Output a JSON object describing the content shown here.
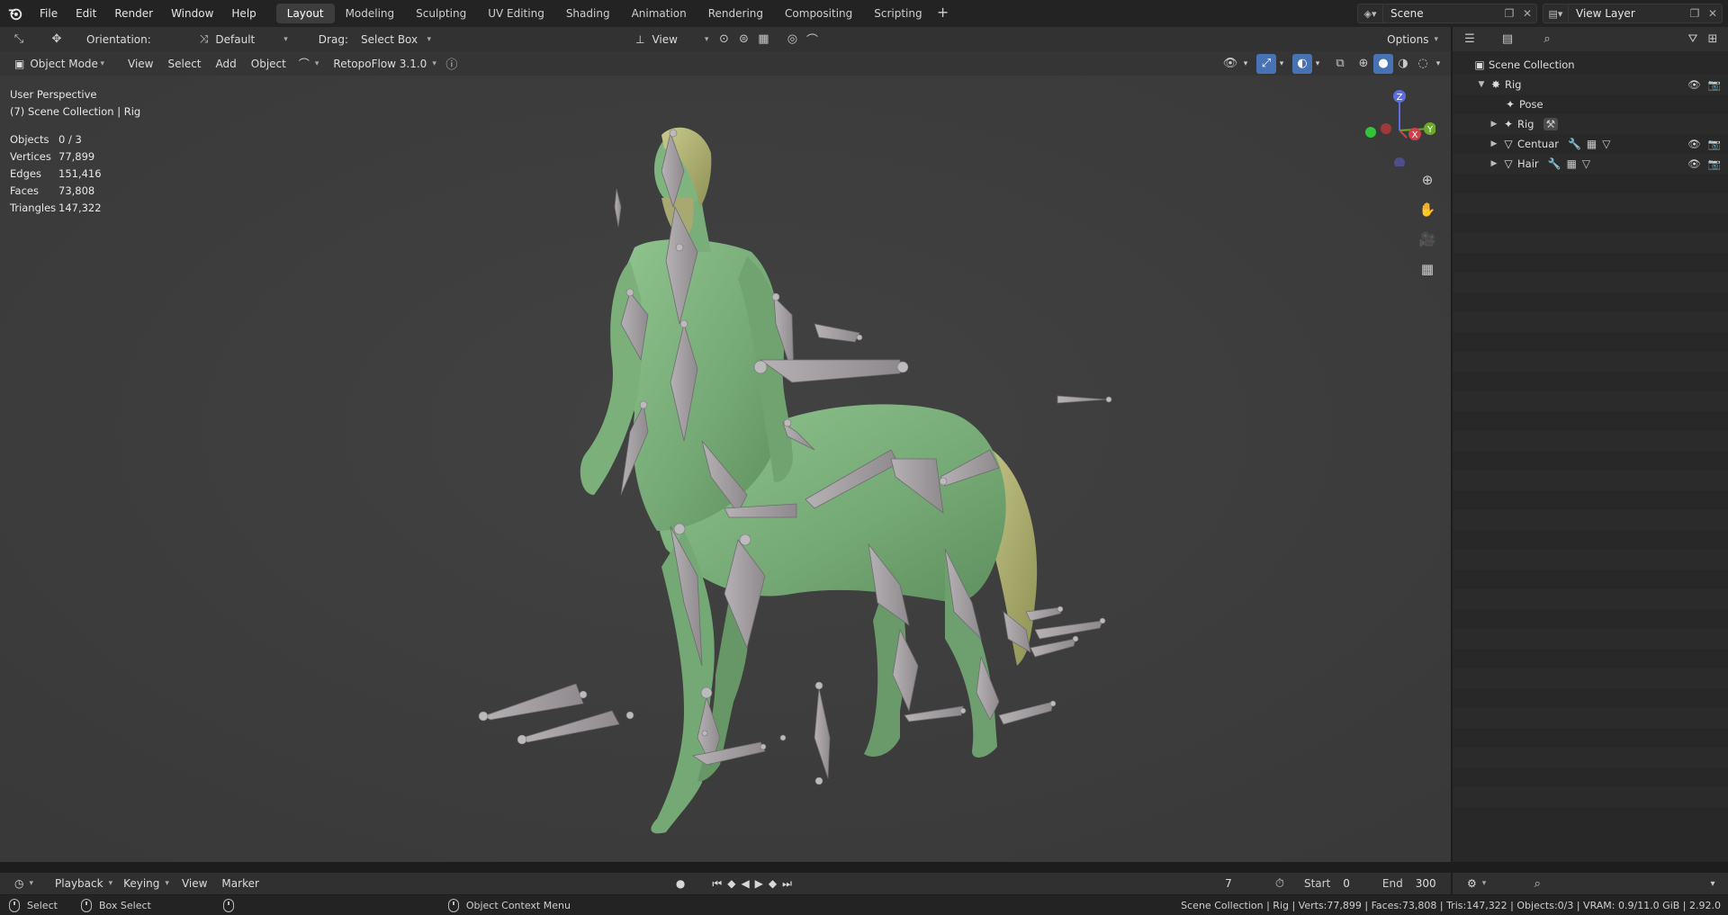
{
  "topbar": {
    "menus": [
      "File",
      "Edit",
      "Render",
      "Window",
      "Help"
    ],
    "workspaces": [
      "Layout",
      "Modeling",
      "Sculpting",
      "UV Editing",
      "Shading",
      "Animation",
      "Rendering",
      "Compositing",
      "Scripting"
    ],
    "active_workspace": "Layout",
    "scene_name": "Scene",
    "view_layer": "View Layer"
  },
  "viewport": {
    "tool_header": {
      "orientation_label": "Orientation:",
      "orientation_value": "Default",
      "drag_label": "Drag:",
      "drag_value": "Select Box",
      "transform_pivot": "View",
      "options": "Options"
    },
    "header": {
      "mode": "Object Mode",
      "menus": [
        "View",
        "Select",
        "Add",
        "Object"
      ],
      "addon": "RetopoFlow 3.1.0"
    },
    "overlay": {
      "perspective": "User Perspective",
      "context": "(7) Scene Collection | Rig",
      "stats": [
        {
          "label": "Objects",
          "value": "0 / 3"
        },
        {
          "label": "Vertices",
          "value": "77,899"
        },
        {
          "label": "Edges",
          "value": "151,416"
        },
        {
          "label": "Faces",
          "value": "73,808"
        },
        {
          "label": "Triangles",
          "value": "147,322"
        }
      ]
    },
    "gizmo_axes": {
      "x": "X",
      "y": "Y",
      "z": "Z"
    },
    "colors": {
      "mesh": "#7fb07f",
      "bone": "#a7a3a6",
      "background": "#3d3d3d",
      "accent": "#4772b3"
    }
  },
  "outliner": {
    "items": [
      {
        "label": "Scene Collection",
        "icon": "collection-icon",
        "depth": 0
      },
      {
        "label": "Rig",
        "icon": "armature-icon",
        "depth": 1,
        "expanded": true
      },
      {
        "label": "Pose",
        "icon": "pose-icon",
        "depth": 2
      },
      {
        "label": "Rig",
        "icon": "armature-data-icon",
        "depth": 2
      },
      {
        "label": "Centuar",
        "icon": "mesh-icon",
        "depth": 2
      },
      {
        "label": "Hair",
        "icon": "mesh-icon",
        "depth": 2
      }
    ]
  },
  "timeline": {
    "menus": [
      "Playback",
      "Keying",
      "View",
      "Marker"
    ],
    "current_frame": "7",
    "start_label": "Start",
    "start": "0",
    "end_label": "End",
    "end": "300"
  },
  "statusbar": {
    "select": "Select",
    "box_select": "Box Select",
    "context_menu": "Object Context Menu",
    "info": "Scene Collection | Rig | Verts:77,899 | Faces:73,808 | Tris:147,322 | Objects:0/3 | VRAM: 0.9/11.0 GiB | 2.92.0"
  }
}
